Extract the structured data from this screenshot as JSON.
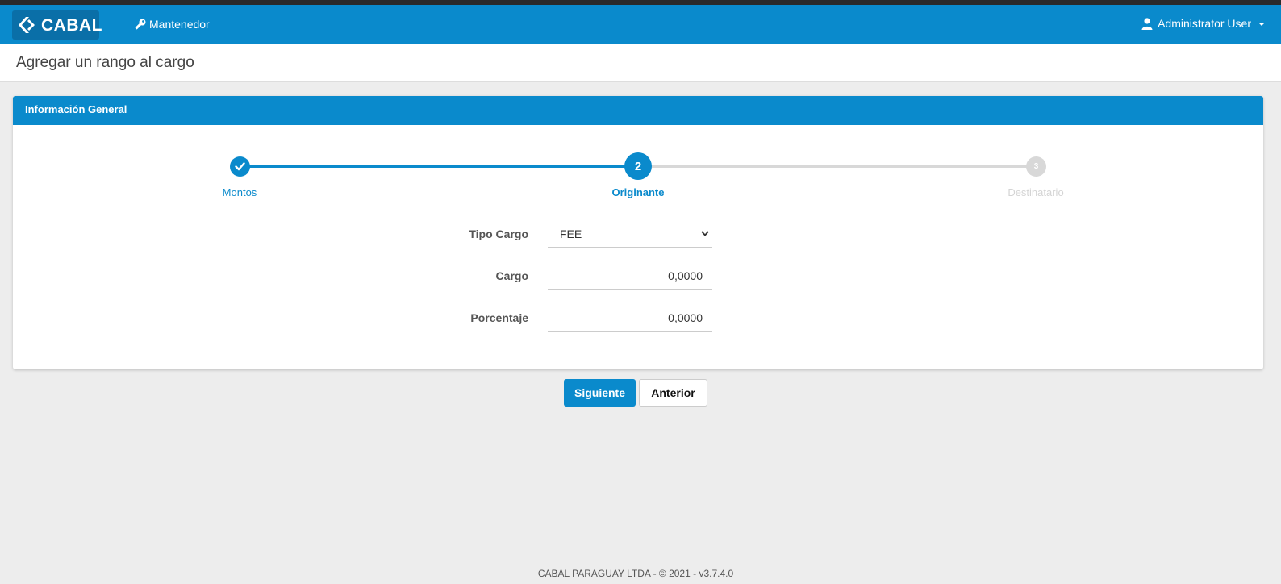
{
  "navbar": {
    "brand": "CABAL",
    "menu_label": "Mantenedor",
    "user_label": "Administrator User"
  },
  "page": {
    "title": "Agregar un rango al cargo"
  },
  "panel": {
    "heading": "Información General"
  },
  "wizard": {
    "steps": [
      {
        "number": "1",
        "label": "Montos",
        "state": "done"
      },
      {
        "number": "2",
        "label": "Originante",
        "state": "active"
      },
      {
        "number": "3",
        "label": "Destinatario",
        "state": "pending"
      }
    ]
  },
  "form": {
    "tipo_cargo_label": "Tipo Cargo",
    "tipo_cargo_value": "FEE",
    "cargo_label": "Cargo",
    "cargo_value": "0,0000",
    "porcentaje_label": "Porcentaje",
    "porcentaje_value": "0,0000"
  },
  "buttons": {
    "next": "Siguiente",
    "prev": "Anterior"
  },
  "footer": {
    "text": "CABAL PARAGUAY LTDA - © 2021 - v3.7.4.0"
  },
  "colors": {
    "primary": "#0a8acc",
    "inactive": "#d8d8d8",
    "background": "#ededed"
  }
}
